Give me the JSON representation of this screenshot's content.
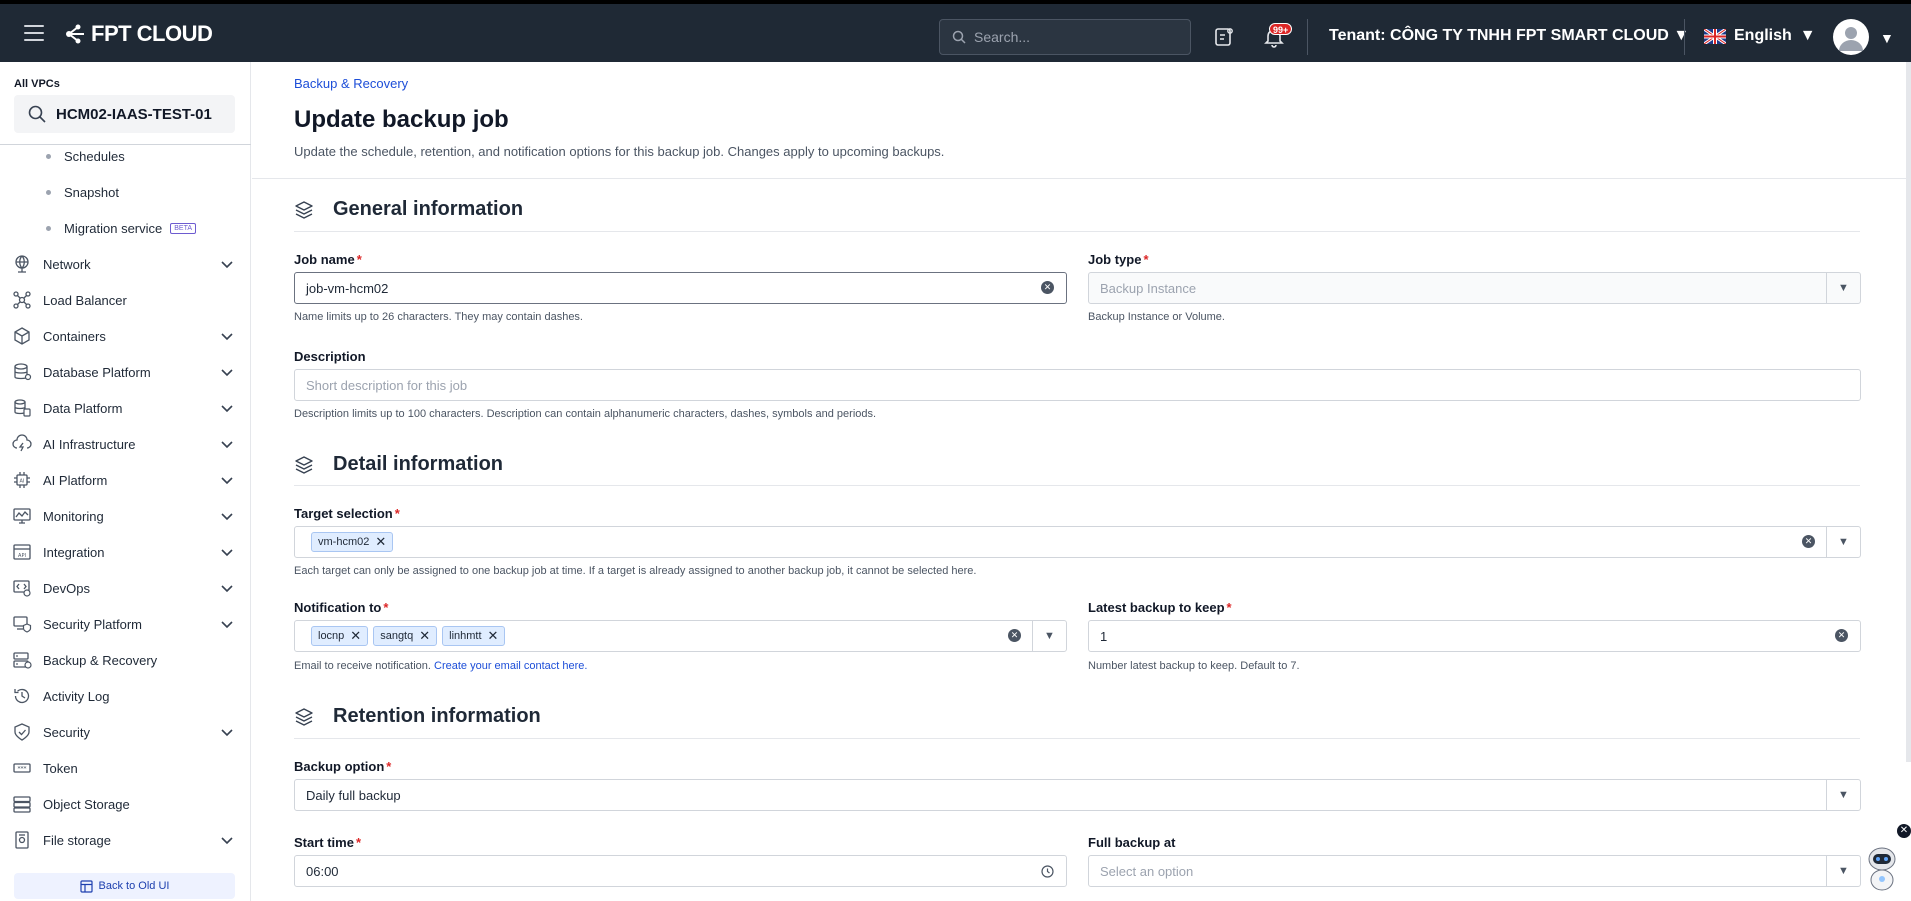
{
  "topbar": {
    "brand": "FPT CLOUD",
    "search_placeholder": "Search...",
    "notification_badge": "99+",
    "tenant_label": "Tenant:",
    "tenant_name": "CÔNG TY TNHH FPT SMART CLOUD",
    "language": "English"
  },
  "sidebar": {
    "vpc_label": "All VPCs",
    "vpc_name": "HCM02-IAAS-TEST-01",
    "sub_items": [
      "Schedules",
      "Snapshot",
      "Migration service"
    ],
    "beta_badge": "BETA",
    "items": [
      {
        "label": "Network",
        "icon": "globe-icon",
        "expandable": true
      },
      {
        "label": "Load Balancer",
        "icon": "load-balancer-icon",
        "expandable": false
      },
      {
        "label": "Containers",
        "icon": "cube-icon",
        "expandable": true
      },
      {
        "label": "Database Platform",
        "icon": "database-icon",
        "expandable": true
      },
      {
        "label": "Data Platform",
        "icon": "data-platform-icon",
        "expandable": true
      },
      {
        "label": "AI Infrastructure",
        "icon": "ai-infrastructure-icon",
        "expandable": true
      },
      {
        "label": "AI Platform",
        "icon": "ai-chip-icon",
        "expandable": true
      },
      {
        "label": "Monitoring",
        "icon": "monitoring-icon",
        "expandable": true
      },
      {
        "label": "Integration",
        "icon": "api-icon",
        "expandable": true
      },
      {
        "label": "DevOps",
        "icon": "devops-icon",
        "expandable": true
      },
      {
        "label": "Security Platform",
        "icon": "security-platform-icon",
        "expandable": true
      },
      {
        "label": "Backup & Recovery",
        "icon": "backup-icon",
        "expandable": false
      },
      {
        "label": "Activity Log",
        "icon": "history-icon",
        "expandable": false
      },
      {
        "label": "Security",
        "icon": "shield-icon",
        "expandable": true
      },
      {
        "label": "Token",
        "icon": "token-icon",
        "expandable": false
      },
      {
        "label": "Object Storage",
        "icon": "object-storage-icon",
        "expandable": false
      },
      {
        "label": "File storage",
        "icon": "file-storage-icon",
        "expandable": true
      }
    ],
    "back_old_ui": "Back to Old UI"
  },
  "page": {
    "breadcrumb": "Backup & Recovery",
    "title": "Update backup job",
    "subtitle": "Update the schedule, retention, and notification options for this backup job. Changes apply to upcoming backups."
  },
  "general": {
    "heading": "General information",
    "job_name_label": "Job name",
    "job_name_value": "job-vm-hcm02",
    "job_name_hint": "Name limits up to 26 characters. They may contain dashes.",
    "job_type_label": "Job type",
    "job_type_value": "Backup Instance",
    "job_type_hint": "Backup Instance or Volume.",
    "description_label": "Description",
    "description_placeholder": "Short description for this job",
    "description_hint": "Description limits up to 100 characters. Description can contain alphanumeric characters, dashes, symbols and periods."
  },
  "detail": {
    "heading": "Detail information",
    "target_label": "Target selection",
    "targets": [
      "vm-hcm02"
    ],
    "target_hint": "Each target can only be assigned to one backup job at time. If a target is already assigned to another backup job, it cannot be selected here.",
    "notification_label": "Notification to",
    "recipients": [
      "locnp",
      "sangtq",
      "linhmtt"
    ],
    "notification_hint": "Email to receive notification.",
    "notification_link": "Create your email contact here.",
    "latest_label": "Latest backup to keep",
    "latest_value": "1",
    "latest_hint": "Number latest backup to keep. Default to 7."
  },
  "retention": {
    "heading": "Retention information",
    "backup_option_label": "Backup option",
    "backup_option_value": "Daily full backup",
    "start_time_label": "Start time",
    "start_time_value": "06:00",
    "full_backup_label": "Full backup at",
    "full_backup_placeholder": "Select an option"
  },
  "colors": {
    "topbar": "#1f2935",
    "link": "#1d4ed8",
    "required": "#dc2626",
    "chip_bg": "#e0edff"
  }
}
